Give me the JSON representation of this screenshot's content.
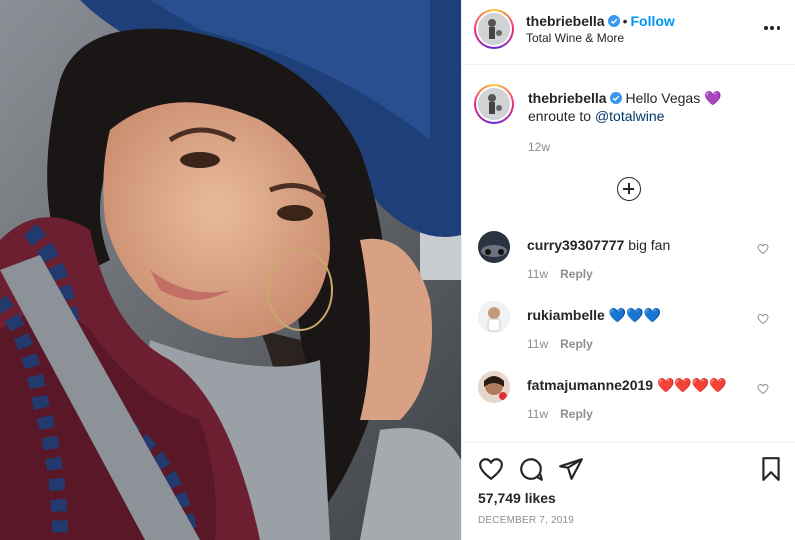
{
  "post": {
    "author": "thebriebella",
    "follow_label": "Follow",
    "separator": "•",
    "location": "Total Wine & More",
    "more_icon": "more-options-icon"
  },
  "caption": {
    "author": "thebriebella",
    "text_before": "Hello Vegas 💜",
    "text_line2": "enroute to ",
    "mention": "@totalwine",
    "time": "12w"
  },
  "comments": [
    {
      "user": "curry39307777",
      "text": "big fan",
      "time": "11w",
      "reply": "Reply"
    },
    {
      "user": "rukiambelle",
      "text": "💙💙💙",
      "time": "11w",
      "reply": "Reply"
    },
    {
      "user": "fatmajumanne2019",
      "text": "❤️❤️❤️❤️",
      "time": "11w",
      "reply": "Reply"
    }
  ],
  "likes": "57,749 likes",
  "date": "December 7, 2019",
  "colors": {
    "link": "#0095f6",
    "verified": "#3897f0",
    "muted": "#8e8e8e",
    "border": "#efefef"
  }
}
